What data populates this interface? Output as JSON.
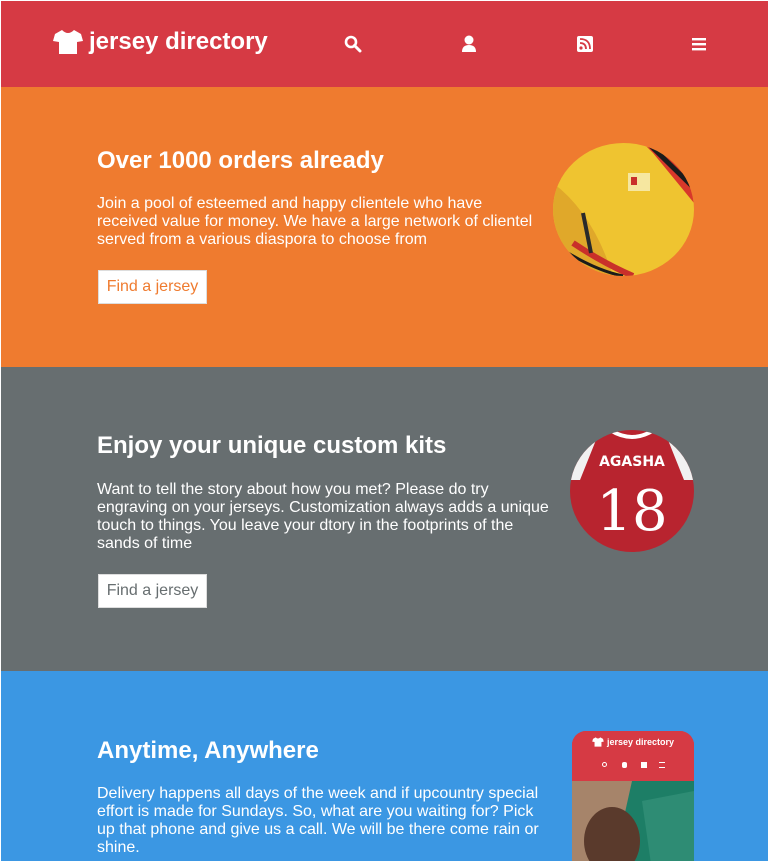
{
  "colors": {
    "header": "#d63a44",
    "section1": "#ef7b2f",
    "section2": "#676e70",
    "section3": "#3b97e3",
    "button_text_1": "#ef7b2f",
    "button_text_2": "#676e70"
  },
  "header": {
    "brand": "jersey directory",
    "brand_icon": "tshirt-icon",
    "icons": [
      "search-icon",
      "user-icon",
      "rss-icon",
      "menu-icon"
    ]
  },
  "sections": [
    {
      "title": "Over 1000 orders already",
      "body": "Join a pool of esteemed and happy clientele who have received value for money. We have a large network of clientel served from a various diaspora to choose from",
      "button": "Find a jersey",
      "image": "yellow-jersey-photo"
    },
    {
      "title": "Enjoy your unique custom kits",
      "body": "Want to tell the story about how you met? Please do try engraving on your jerseys. Customization always adds a unique touch to things. You leave your dtory in the footprints of the sands of time",
      "button": "Find a jersey",
      "image": "custom-jersey-photo",
      "jersey_name": "AGASHA",
      "jersey_number": "18"
    },
    {
      "title": "Anytime, Anywhere",
      "body": "Delivery happens all days of the week and if upcountry special effort is made for Sundays. So, what are you waiting for? Pick up that phone and give us a call. We will be there come rain or shine.",
      "image": "mobile-app-preview",
      "phone_brand": "jersey directory"
    }
  ]
}
